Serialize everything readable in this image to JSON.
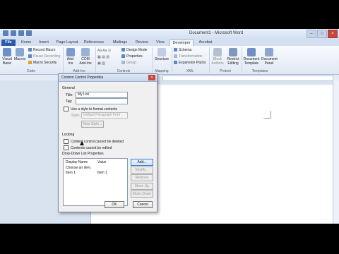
{
  "window": {
    "title": "Document1 - Microsoft Word"
  },
  "tabs": [
    "File",
    "Home",
    "Insert",
    "Page Layout",
    "References",
    "Mailings",
    "Review",
    "View",
    "Developer",
    "Acrobat"
  ],
  "ribbon": {
    "code": {
      "visual_basic": "Visual Basic",
      "macros": "Macros",
      "record_macro": "Record Macro",
      "pause_recording": "Pause Recording",
      "macro_security": "Macro Security",
      "group": "Code"
    },
    "addins": {
      "addins": "Add-Ins",
      "com_addins": "COM Add-Ins",
      "group": "Add-Ins"
    },
    "controls": {
      "design_mode": "Design Mode",
      "properties": "Properties",
      "group_btn": "Group",
      "group": "Controls"
    },
    "mapping": {
      "structure": "Structure",
      "group": "Mapping"
    },
    "xml": {
      "schema": "Schema",
      "transformation": "Transformation",
      "expansion_packs": "Expansion Packs",
      "group": "XML"
    },
    "protect": {
      "block_authors": "Block Authors",
      "restrict_editing": "Restrict Editing",
      "group": "Protect"
    },
    "templates": {
      "document_template": "Document Template",
      "document_panel": "Document Panel",
      "group": "Templates"
    }
  },
  "dialog": {
    "title": "Content Control Properties",
    "close": "x",
    "general": "General",
    "title_label": "Title:",
    "title_value": "My List",
    "tag_label": "Tag:",
    "tag_value": "",
    "use_style": "Use a style to format contents",
    "style_label": "Style:",
    "style_value": "Default Paragraph Font",
    "new_style": "New Style...",
    "locking": "Locking",
    "cannot_delete": "Content control cannot be deleted",
    "cannot_edit": "Contents cannot be edited",
    "ddl_props": "Drop-Down List Properties",
    "col_display": "Display Name",
    "col_value": "Value",
    "rows": [
      {
        "display": "Choose an item.",
        "value": ""
      },
      {
        "display": "Item 1",
        "value": "Item 1"
      }
    ],
    "btn_add": "Add...",
    "btn_modify": "Modify...",
    "btn_remove": "Remove",
    "btn_move_up": "Move Up",
    "btn_move_down": "Move Down",
    "ok": "OK",
    "cancel": "Cancel"
  }
}
